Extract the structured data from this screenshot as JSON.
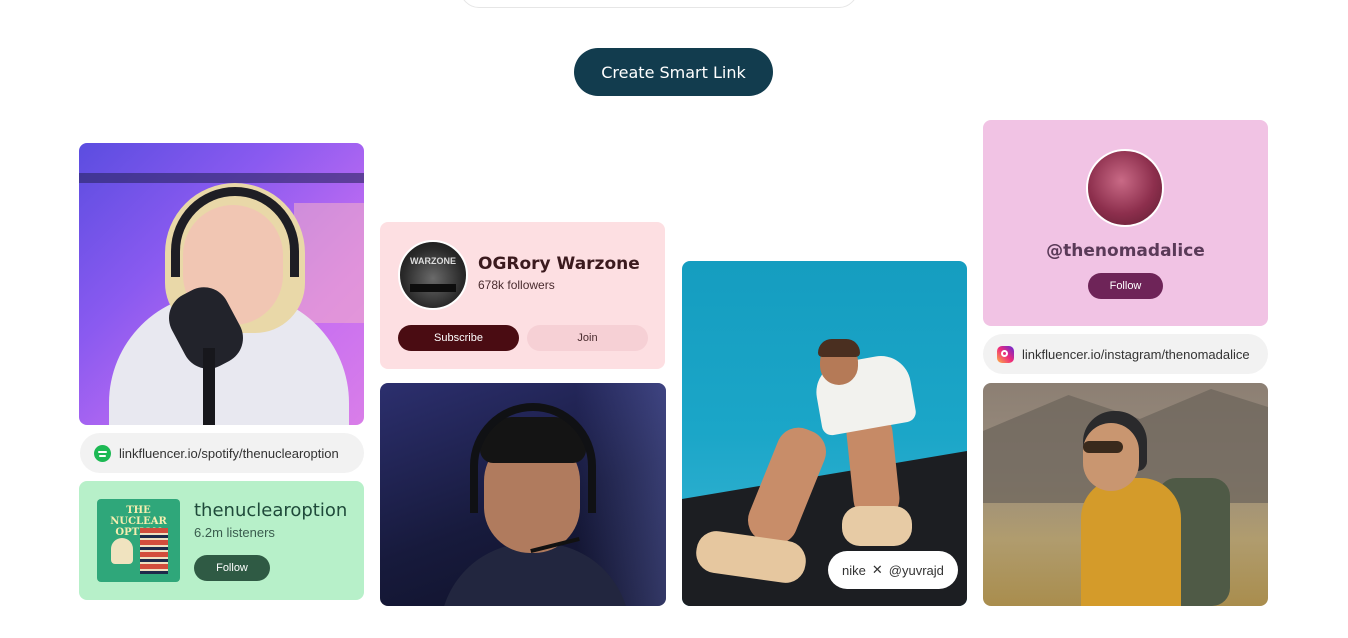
{
  "cta": {
    "label": "Create Smart Link"
  },
  "column1": {
    "spotify_link": "linkfluencer.io/spotify/thenuclearoption",
    "podcast_card": {
      "album_title": "THE NUCLEAR OPTION",
      "name": "thenuclearoption",
      "listeners": "6.2m listeners",
      "follow_label": "Follow"
    }
  },
  "column2": {
    "creator_card": {
      "avatar_text": "WARZONE",
      "name": "OGRory Warzone",
      "followers": "678k followers",
      "subscribe_label": "Subscribe",
      "join_label": "Join"
    }
  },
  "column3": {
    "collab_tag": {
      "brand": "nike",
      "separator": "✕",
      "handle": "@yuvrajd"
    }
  },
  "column4": {
    "profile_card": {
      "handle": "@thenomadalice",
      "follow_label": "Follow"
    },
    "instagram_link": "linkfluencer.io/instagram/thenomadalice"
  },
  "colors": {
    "cta_bg": "#123c4e",
    "green_card": "#b7f0c9",
    "rose_card": "#fddfe2",
    "pink_card": "#f1c3e4"
  }
}
